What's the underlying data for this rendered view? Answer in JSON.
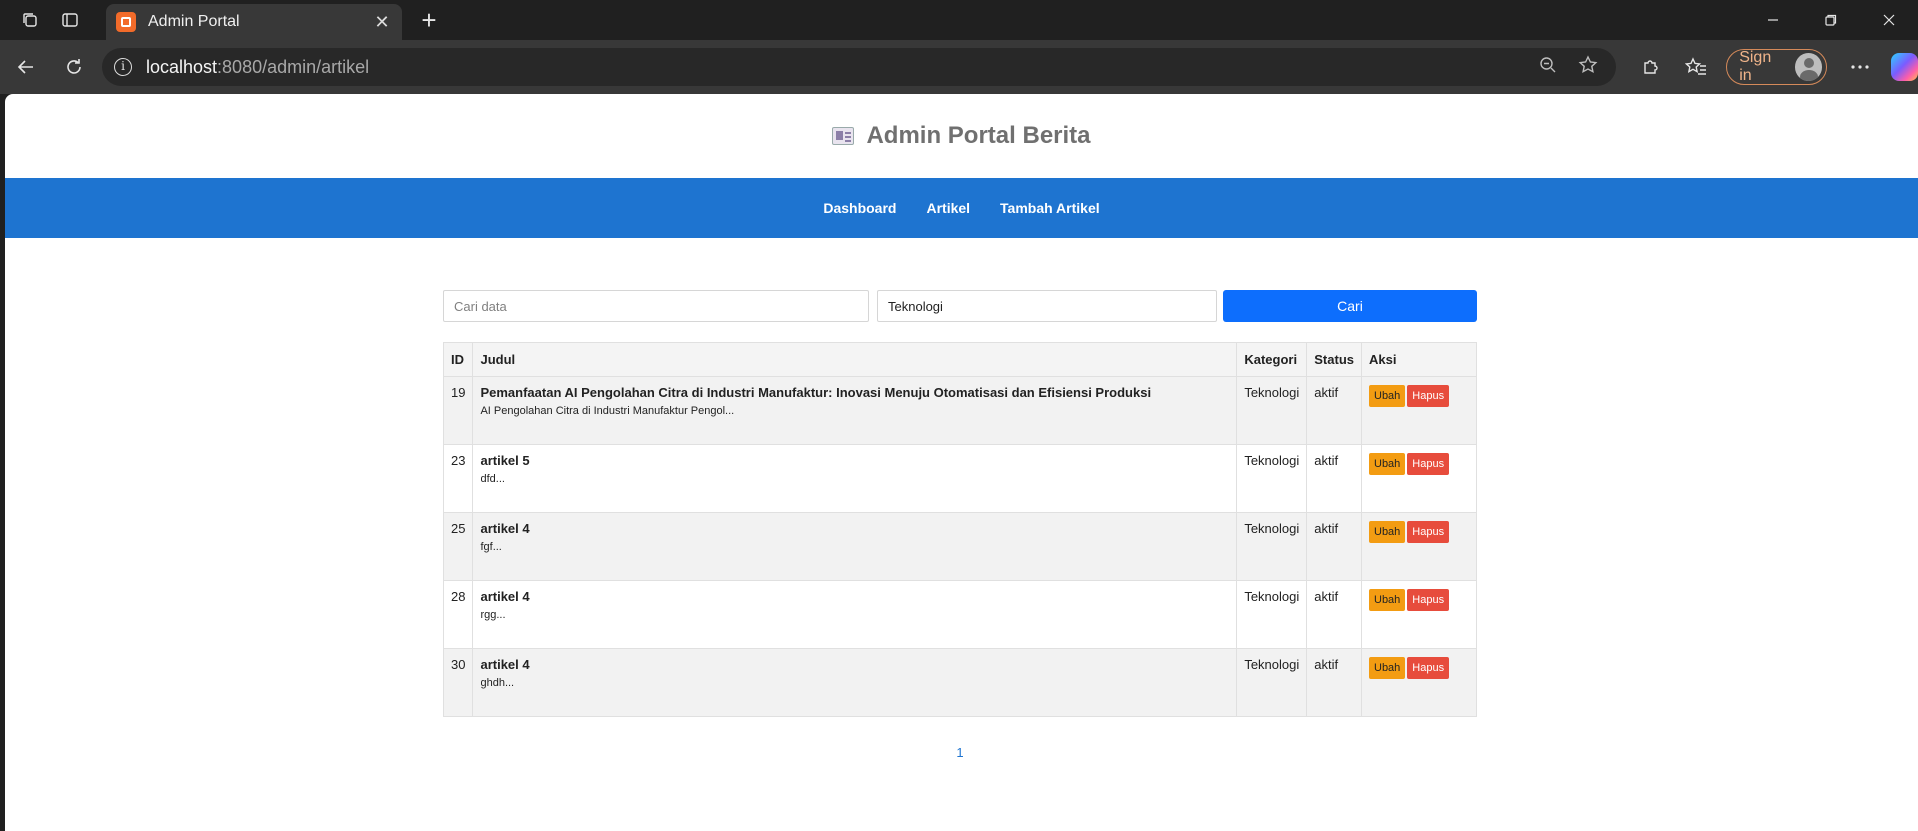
{
  "browser": {
    "tab_title": "Admin Portal",
    "tab_close": "✕",
    "new_tab": "+",
    "url_host": "localhost",
    "url_rest": ":8080/admin/artikel",
    "sign_in": "Sign in"
  },
  "site": {
    "title": "Admin Portal Berita",
    "nav": [
      "Dashboard",
      "Artikel",
      "Tambah Artikel"
    ]
  },
  "search": {
    "placeholder": "Cari data",
    "category": "Teknologi",
    "button": "Cari"
  },
  "table": {
    "headers": [
      "ID",
      "Judul",
      "Kategori",
      "Status",
      "Aksi"
    ],
    "rows": [
      {
        "id": "19",
        "title": "Pemanfaatan AI Pengolahan Citra di Industri Manufaktur: Inovasi Menuju Otomatisasi dan Efisiensi Produksi",
        "excerpt": "AI Pengolahan Citra di Industri Manufaktur Pengol...",
        "category": "Teknologi",
        "status": "aktif"
      },
      {
        "id": "23",
        "title": "artikel 5",
        "excerpt": "dfd...",
        "category": "Teknologi",
        "status": "aktif"
      },
      {
        "id": "25",
        "title": "artikel 4",
        "excerpt": "fgf...",
        "category": "Teknologi",
        "status": "aktif"
      },
      {
        "id": "28",
        "title": "artikel 4",
        "excerpt": "rgg...",
        "category": "Teknologi",
        "status": "aktif"
      },
      {
        "id": "30",
        "title": "artikel 4",
        "excerpt": "ghdh...",
        "category": "Teknologi",
        "status": "aktif"
      }
    ],
    "edit_label": "Ubah",
    "delete_label": "Hapus"
  },
  "pagination": {
    "current": "1"
  }
}
